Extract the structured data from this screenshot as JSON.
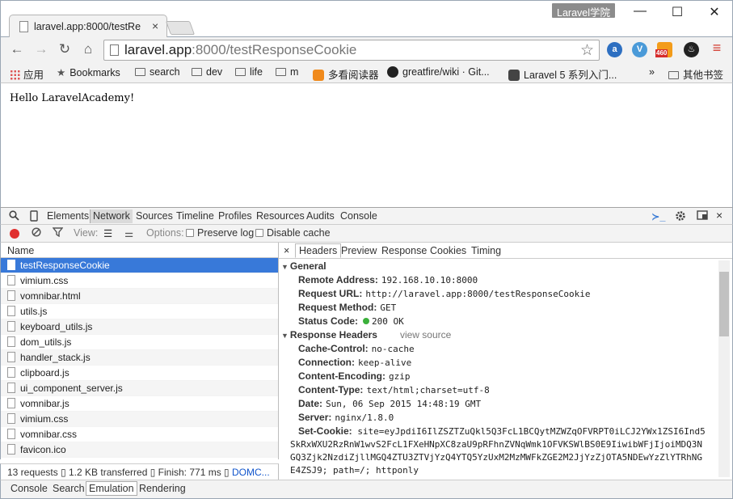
{
  "window": {
    "tab_title": "laravel.app:8000/testRe",
    "tab_close": "×",
    "profile_badge": "Laravel学院",
    "minimize": "—",
    "maximize": "☐",
    "close": "✕"
  },
  "toolbar": {
    "back_icon": "←",
    "forward_icon": "→",
    "reload_icon": "↻",
    "home_icon": "⌂",
    "url_host": "laravel.app",
    "url_rest": ":8000/testResponseCookie",
    "star_icon": "☆",
    "ext_badge": "460",
    "menu_icon": "≡"
  },
  "bookmarks": {
    "apps": "应用",
    "bookmarks": "Bookmarks",
    "items": [
      "search",
      "dev",
      "life",
      "m"
    ],
    "reader": "多看阅读器",
    "github": "greatfire/wiki · Git...",
    "laravel": "Laravel 5 系列入门...",
    "more": "»",
    "other": "其他书签"
  },
  "page": {
    "text": "Hello LaravelAcademy!"
  },
  "devtools": {
    "tabs": [
      "Elements",
      "Network",
      "Sources",
      "Timeline",
      "Profiles",
      "Resources",
      "Audits",
      "Console"
    ],
    "selected_tab": "Network",
    "view_label": "View:",
    "options_label": "Options:",
    "preserve_log": "Preserve log",
    "disable_cache": "Disable cache",
    "name_header": "Name",
    "requests": [
      "testResponseCookie",
      "vimium.css",
      "vomnibar.html",
      "utils.js",
      "keyboard_utils.js",
      "dom_utils.js",
      "handler_stack.js",
      "clipboard.js",
      "ui_component_server.js",
      "vomnibar.js",
      "vimium.css",
      "vomnibar.css",
      "favicon.ico"
    ],
    "selected_request": "testResponseCookie",
    "status_requests": "13 requests",
    "status_transferred": "1.2 KB transferred",
    "status_finish": "Finish: 771 ms",
    "status_dom": "DOMC...",
    "detail_close": "×",
    "detail_tabs": [
      "Headers",
      "Preview",
      "Response",
      "Cookies",
      "Timing"
    ],
    "selected_detail_tab": "Headers",
    "general_title": "General",
    "general": [
      {
        "k": "Remote Address:",
        "v": "192.168.10.10:8000"
      },
      {
        "k": "Request URL:",
        "v": "http://laravel.app:8000/testResponseCookie"
      },
      {
        "k": "Request Method:",
        "v": "GET"
      },
      {
        "k": "Status Code:",
        "v": "200 OK"
      }
    ],
    "response_headers_title": "Response Headers",
    "view_source": "view source",
    "response_headers": [
      {
        "k": "Cache-Control:",
        "v": "no-cache"
      },
      {
        "k": "Connection:",
        "v": "keep-alive"
      },
      {
        "k": "Content-Encoding:",
        "v": "gzip"
      },
      {
        "k": "Content-Type:",
        "v": "text/html;charset=utf-8"
      },
      {
        "k": "Date:",
        "v": "Sun, 06 Sep 2015 14:48:19 GMT"
      },
      {
        "k": "Server:",
        "v": "nginx/1.8.0"
      }
    ],
    "set_cookie_key": "Set-Cookie:",
    "set_cookie_value": "site=eyJpdiI6IlZSZTZuQkl5Q3FcL1BCQytMZWZqOFVRPT0iLCJ2YWx1ZSI6Ind5SkRxWXU2RzRnW1wvS2FcL1FXeHNpXC8zaU9pRFhnZVNqWmk1OFVKSWlBS0E9IiwibWFjIjoiMDQ3NGQ3Zjk2NzdiZjllMGQ4ZTU3ZTVjYzQ4YTQ5YzUxM2MzMWFkZGE2M2JjYzZjOTA5NDEwYzZlYTRhNGE4ZSJ9; path=/; httponly",
    "drawer_tabs": [
      "Console",
      "Search",
      "Emulation",
      "Rendering"
    ],
    "selected_drawer_tab": "Emulation"
  },
  "colors": {
    "selection": "#3879d9",
    "record": "#e0302f",
    "status_ok": "#3bb03b"
  }
}
